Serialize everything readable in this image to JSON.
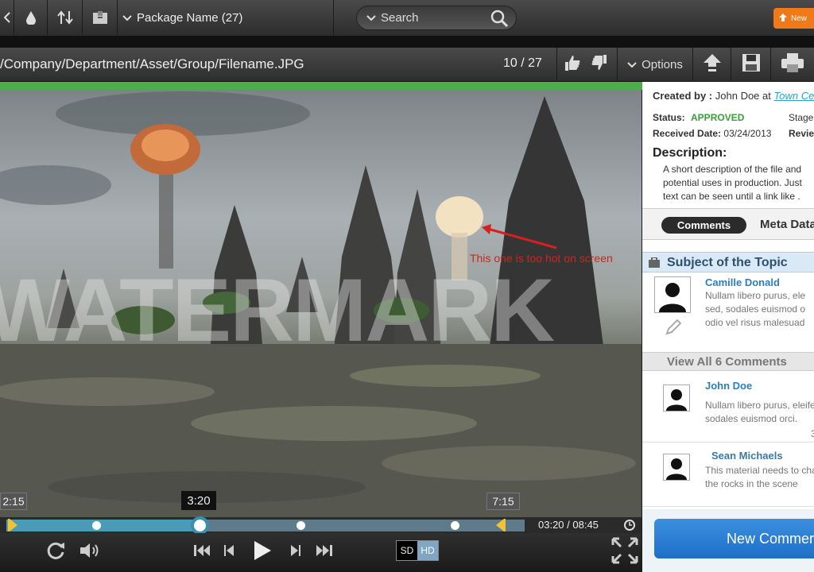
{
  "topbar": {
    "package_label": "Package Name (27)",
    "search_placeholder": "Search",
    "new_label": "New"
  },
  "pathbar": {
    "path": "/Company/Department/Asset/Group/Filename.JPG",
    "counter": "10 / 27",
    "options_label": "Options"
  },
  "viewer": {
    "watermark": "WATERMARK",
    "annotation": "This one is too hot on screen"
  },
  "timeline": {
    "in_marker": "2:15",
    "playhead": "3:20",
    "out_marker": "7:15",
    "time_readout": "03:20 / 08:45",
    "progress": 0.38
  },
  "controls": {
    "sd_label": "SD",
    "hd_label": "HD"
  },
  "panel": {
    "created_by_label": "Created by :",
    "created_by_name": "John Doe at",
    "created_by_link": "Town Ce",
    "status_label": "Status:",
    "status_value": "APPROVED",
    "stage_label": "Stage",
    "received_label": "Received Date:",
    "received_value": "03/24/2013",
    "review_label": "Revie",
    "description_title": "Description:",
    "description_lines": [
      "A short description of the file and",
      "potential uses in production. Just",
      "text can be seen until a link like ."
    ],
    "tabs": {
      "comments": "Comments",
      "meta": "Meta Data"
    },
    "topic_title": "Subject of the Topic",
    "view_all": "View All 6 Comments",
    "new_comment": "New Commer",
    "comments": [
      {
        "name": "Camille Donald",
        "lines": [
          "Nullam libero purus, ele",
          "sed, sodales euismod o",
          "odio vel risus malesuad"
        ]
      },
      {
        "name": "John Doe",
        "lines": [
          "Nullam libero purus, eleife",
          "sodales euismod orci."
        ],
        "meta": "3"
      },
      {
        "name": "Sean Michaels",
        "lines": [
          "This material needs to cha",
          "the rocks in the scene"
        ]
      }
    ]
  },
  "colors": {
    "accent_green": "#4aae4a",
    "status_green": "#3a9e3a",
    "link_blue": "#2a7fc0",
    "annotation_red": "#d42020",
    "new_orange": "#f07a1a"
  }
}
